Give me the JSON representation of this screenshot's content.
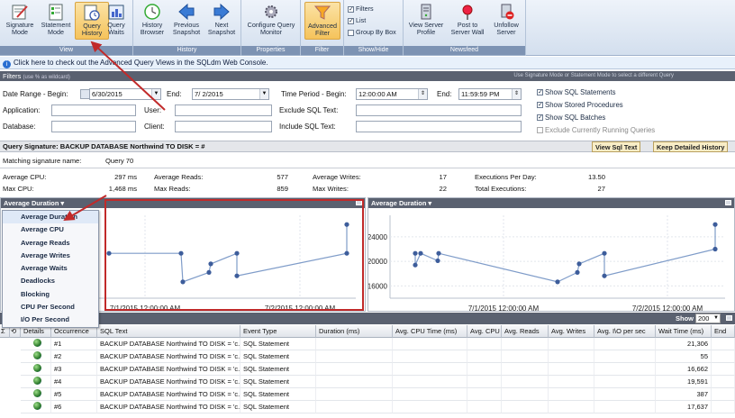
{
  "ribbon": {
    "groups": [
      {
        "label": "View",
        "buttons": [
          "Signature Mode",
          "Statement Mode",
          "Query History",
          "Query Waits"
        ]
      },
      {
        "label": "History",
        "buttons": [
          "History Browser",
          "Previous Snapshot",
          "Next Snapshot"
        ]
      },
      {
        "label": "Properties",
        "buttons": [
          "Configure Query Monitor"
        ]
      },
      {
        "label": "Filter",
        "buttons": [
          "Advanced Filter"
        ]
      },
      {
        "label": "Show/Hide",
        "checks": [
          "Filters",
          "List",
          "Group By Box"
        ]
      },
      {
        "label": "Newsfeed",
        "buttons": [
          "View Server Profile",
          "Post to Server Wall",
          "Unfollow Server"
        ]
      }
    ],
    "check_state": [
      true,
      true,
      false
    ]
  },
  "infobar": "Click here to check out the Advanced Query Views in the SQLdm Web Console.",
  "filters": {
    "title": "Filters",
    "subtitle": "(use % as wildcard)",
    "hint": "Use Signature Mode or Statement Mode to select a different Query",
    "date_range_begin_label": "Date Range - Begin:",
    "date_range_begin_value": "6/30/2015",
    "end_label": "End:",
    "end_value": "7/  2/2015",
    "time_begin_label": "Time Period - Begin:",
    "time_begin_value": "12:00:00 AM",
    "time_end_label": "End:",
    "time_end_value": "11:59:59 PM",
    "application_label": "Application:",
    "database_label": "Database:",
    "user_label": "User:",
    "client_label": "Client:",
    "exclude_sql_label": "Exclude SQL Text:",
    "include_sql_label": "Include SQL Text:",
    "options": [
      {
        "label": "Show SQL Statements",
        "checked": true
      },
      {
        "label": "Show Stored Procedures",
        "checked": true
      },
      {
        "label": "Show SQL Batches",
        "checked": true
      },
      {
        "label": "Exclude Currently Running Queries",
        "checked": false
      }
    ]
  },
  "query_signature": {
    "label": "Query Signature:  BACKUP DATABASE Northwind TO DISK = #",
    "view_sql_button": "View Sql Text",
    "keep_history_button": "Keep Detailed History"
  },
  "stats": {
    "matching_label": "Matching signature name:",
    "matching_value": "Query 70",
    "avg_cpu_label": "Average CPU:",
    "avg_cpu_value": "297 ms",
    "max_cpu_label": "Max CPU:",
    "max_cpu_value": "1,468 ms",
    "avg_reads_label": "Average Reads:",
    "avg_reads_value": "577",
    "max_reads_label": "Max Reads:",
    "max_reads_value": "859",
    "avg_writes_label": "Average Writes:",
    "avg_writes_value": "17",
    "max_writes_label": "Max Writes:",
    "max_writes_value": "22",
    "exec_per_day_label": "Executions Per Day:",
    "exec_per_day_value": "13.50",
    "total_exec_label": "Total Executions:",
    "total_exec_value": "27"
  },
  "chart_menu": {
    "selected": "Average Duration",
    "items": [
      "Average Duration",
      "Average CPU",
      "Average Reads",
      "Average Writes",
      "Average Waits",
      "Deadlocks",
      "Blocking",
      "CPU Per Second",
      "I/O Per Second"
    ]
  },
  "chart_data": [
    {
      "type": "line",
      "title": "Average Duration",
      "x_tick_labels": [
        "7/1/2015 12:00:00 AM",
        "7/2/2015 12:00:00 AM"
      ],
      "series": [
        {
          "values": [
            21306,
            21306,
            16662,
            18200,
            19591,
            21306,
            17637,
            21306,
            26000
          ]
        }
      ]
    },
    {
      "type": "line",
      "title": "Average Duration",
      "y_ticks": [
        "24000",
        "20000",
        "16000"
      ],
      "ylim": [
        14000,
        27500
      ],
      "x_tick_labels": [
        "7/1/2015 12:00:00 AM",
        "7/2/2015 12:00:00 AM"
      ],
      "series": [
        {
          "values": [
            21306,
            19400,
            21306,
            20100,
            21306,
            16662,
            18200,
            19591,
            21306,
            17637,
            22000,
            26000
          ]
        }
      ]
    }
  ],
  "grid": {
    "show_label": "Show",
    "show_count": "200",
    "columns": [
      "Details",
      "Occurrence",
      "SQL Text",
      "Event Type",
      "Duration (ms)",
      "Avg. CPU Time (ms)",
      "Avg. CPU per sec",
      "Avg. Reads",
      "Avg. Writes",
      "Avg. I\\O per sec",
      "Wait Time (ms)",
      "End"
    ],
    "rows": [
      {
        "occurrence": "#1",
        "sql": "BACKUP DATABASE Northwind TO DISK = 'c...",
        "event": "SQL Statement",
        "wait": "21,306"
      },
      {
        "occurrence": "#2",
        "sql": "BACKUP DATABASE Northwind TO DISK = 'c...",
        "event": "SQL Statement",
        "wait": "55"
      },
      {
        "occurrence": "#3",
        "sql": "BACKUP DATABASE Northwind TO DISK = 'c...",
        "event": "SQL Statement",
        "wait": "16,662"
      },
      {
        "occurrence": "#4",
        "sql": "BACKUP DATABASE Northwind TO DISK = 'c...",
        "event": "SQL Statement",
        "wait": "19,591"
      },
      {
        "occurrence": "#5",
        "sql": "BACKUP DATABASE Northwind TO DISK = 'c...",
        "event": "SQL Statement",
        "wait": "387"
      },
      {
        "occurrence": "#6",
        "sql": "BACKUP DATABASE Northwind TO DISK = 'c...",
        "event": "SQL Statement",
        "wait": "17,637"
      }
    ]
  }
}
